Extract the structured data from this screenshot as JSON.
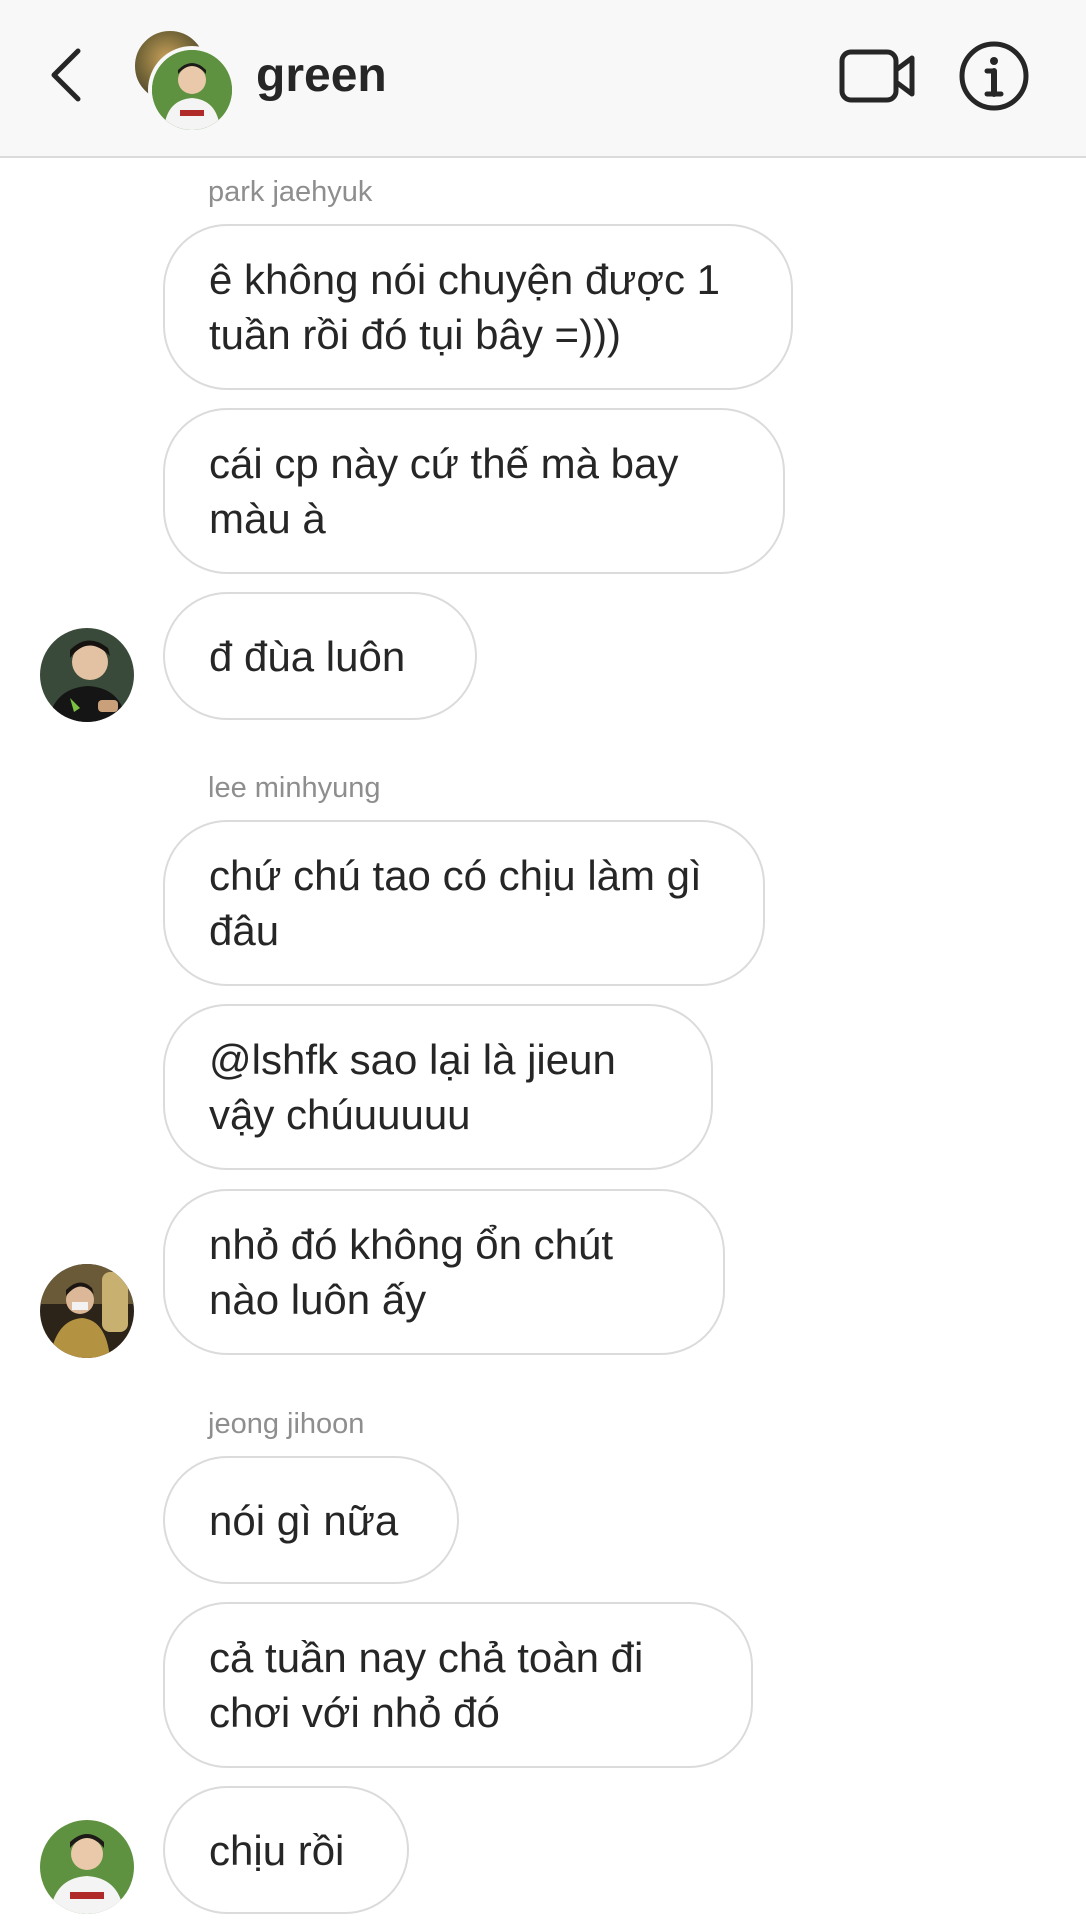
{
  "header": {
    "title": "green",
    "back_icon": "chevron-left-icon",
    "video_icon": "video-camera-icon",
    "info_icon": "info-icon"
  },
  "messages": [
    {
      "sender": "park jaehyuk",
      "bubbles": [
        "ê không nói chuyện được 1 tuần rồi đó tụi bây =)))",
        "cái cp này cứ thế mà bay màu à",
        "đ đùa luôn"
      ]
    },
    {
      "sender": "lee minhyung",
      "bubbles": [
        "chứ chú tao có chịu làm gì đâu",
        "@lshfk sao lại là jieun vậy chúuuuuu",
        "nhỏ đó không ổn chút nào luôn ấy"
      ]
    },
    {
      "sender": "jeong jihoon",
      "bubbles": [
        "nói gì nữa",
        "cả tuần nay chả toàn đi chơi với nhỏ đó",
        "chịu rồi"
      ]
    }
  ]
}
